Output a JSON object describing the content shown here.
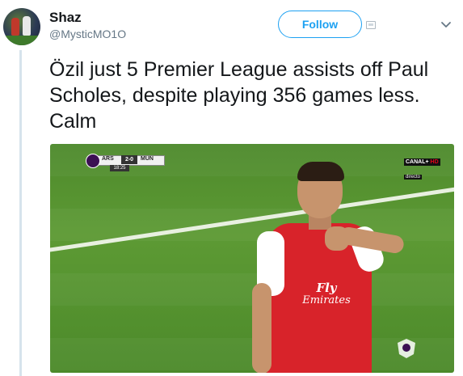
{
  "tweet": {
    "author": {
      "display_name": "Shaz",
      "handle": "@MysticMO1O"
    },
    "follow_label": "Follow",
    "text": "Özil just 5 Premier League assists off Paul Scholes, despite playing 356 games less. Calm"
  },
  "media": {
    "scorebug": {
      "home": "ARS",
      "score": "2-0",
      "away": "MUN",
      "clock": "18:25"
    },
    "broadcaster": {
      "name": "CANAL+",
      "hd": "HD",
      "label": "directo"
    },
    "shirt_sponsor": {
      "line1": "Fly",
      "line2": "Emirates"
    }
  },
  "colors": {
    "accent": "#1da1f2",
    "shirt": "#d8232a",
    "pitch": "#5d9a34"
  },
  "icons": {
    "menu": "chevron-down-icon",
    "media_indicator": "image-icon"
  }
}
